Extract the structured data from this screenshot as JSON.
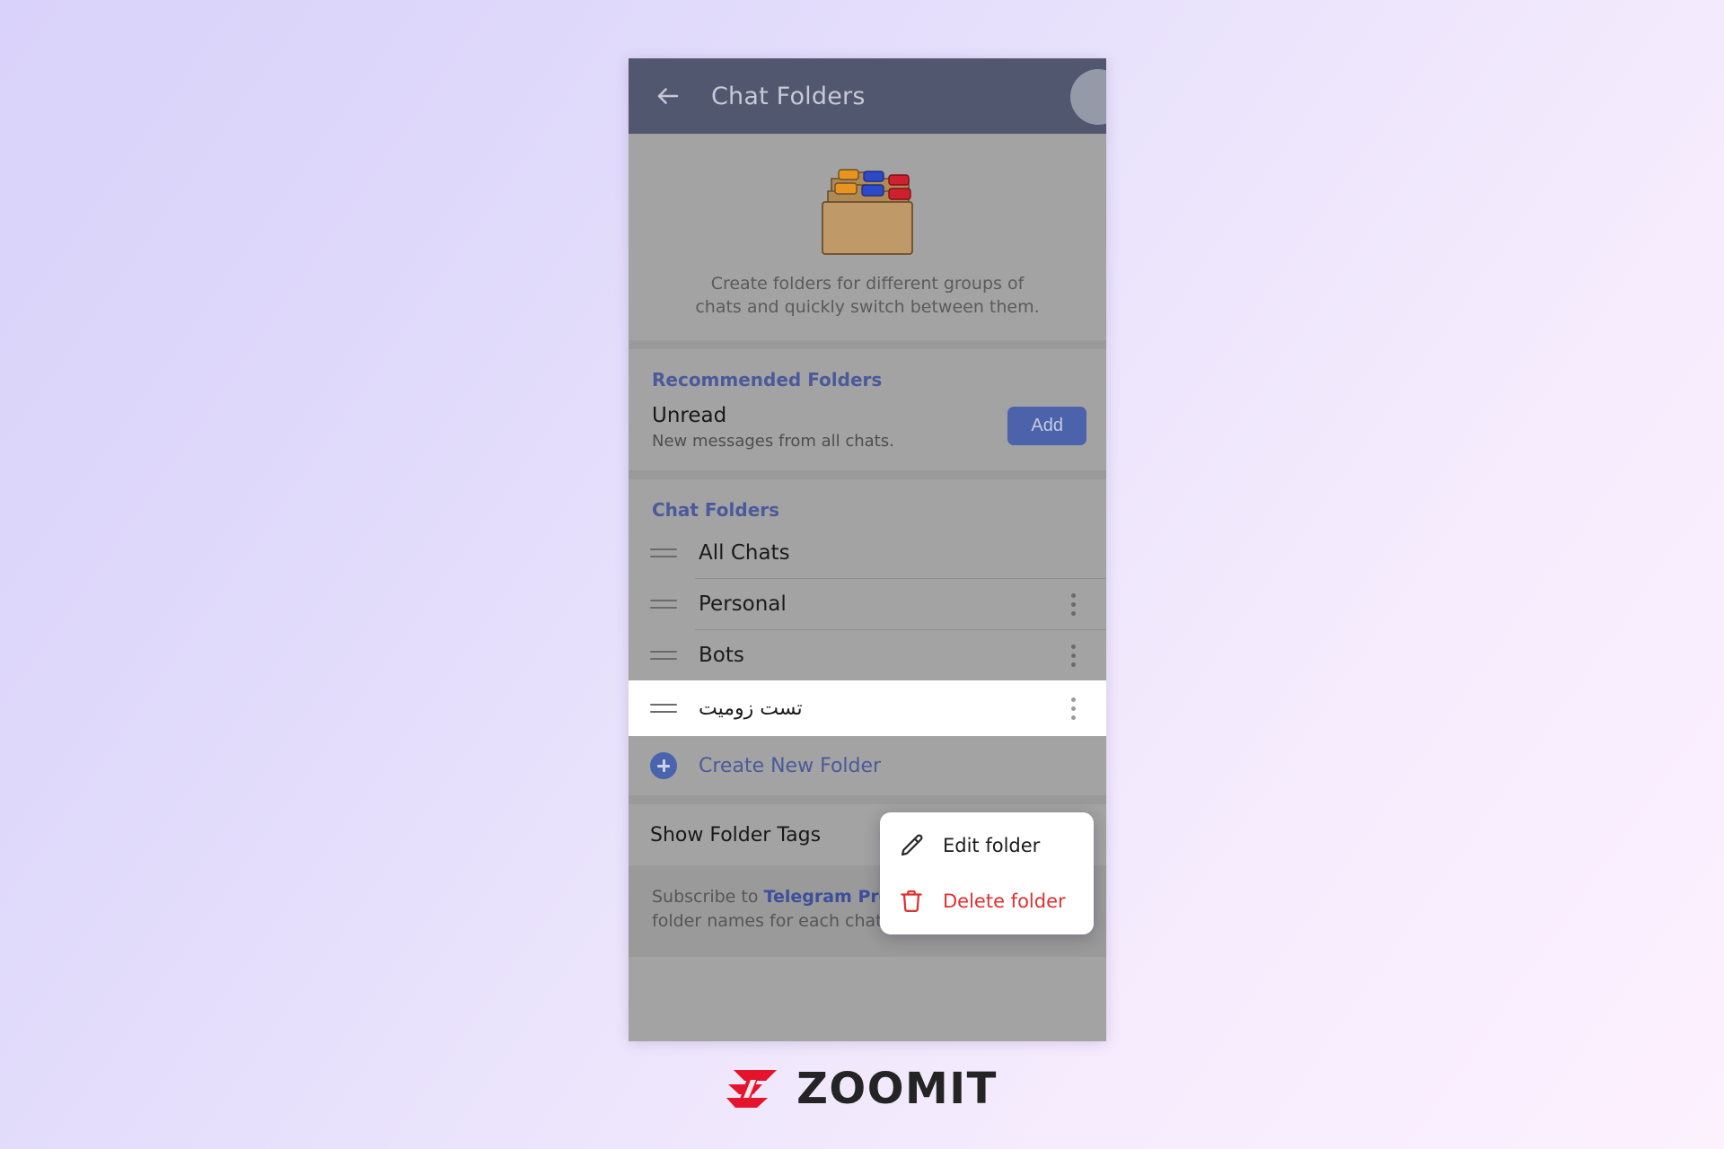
{
  "background": {
    "gradient_from": "#d9d2fa",
    "gradient_to": "#fdf1fe"
  },
  "appbar": {
    "title": "Chat Folders",
    "back_icon": "arrow-left-icon",
    "accent": "#424a6e"
  },
  "hero": {
    "illustration": "folder-box-illustration",
    "caption": "Create folders for different groups of chats and quickly switch between them."
  },
  "recommended": {
    "section_title": "Recommended Folders",
    "title": "Unread",
    "subtitle": "New messages from all chats.",
    "add_label": "Add",
    "add_color": "#4c63ab"
  },
  "chat_folders": {
    "section_title": "Chat Folders",
    "rows": [
      {
        "name": "All Chats",
        "has_menu": false,
        "highlight": false,
        "rtl": false
      },
      {
        "name": "Personal",
        "has_menu": true,
        "highlight": false,
        "rtl": false
      },
      {
        "name": "Bots",
        "has_menu": true,
        "highlight": false,
        "rtl": false
      },
      {
        "name": "تست زومیت",
        "has_menu": true,
        "highlight": true,
        "rtl": true
      }
    ],
    "create_label": "Create New Folder",
    "create_icon": "plus-circle-icon",
    "link_color": "#4a5a9a"
  },
  "tags": {
    "label": "Show Folder Tags",
    "note_prefix": "Subscribe to ",
    "note_link": "Telegram Premium",
    "note_suffix": " to display folder names for each chat in the chat list."
  },
  "context_menu": {
    "items": [
      {
        "label": "Edit folder",
        "icon": "pencil-icon",
        "danger": false
      },
      {
        "label": "Delete folder",
        "icon": "trash-icon",
        "danger": true
      }
    ],
    "danger_color": "#e03030"
  },
  "watermark": {
    "word": "ZOOMIT",
    "mark": "zoomit-z-logo",
    "mark_color": "#e3142c"
  }
}
